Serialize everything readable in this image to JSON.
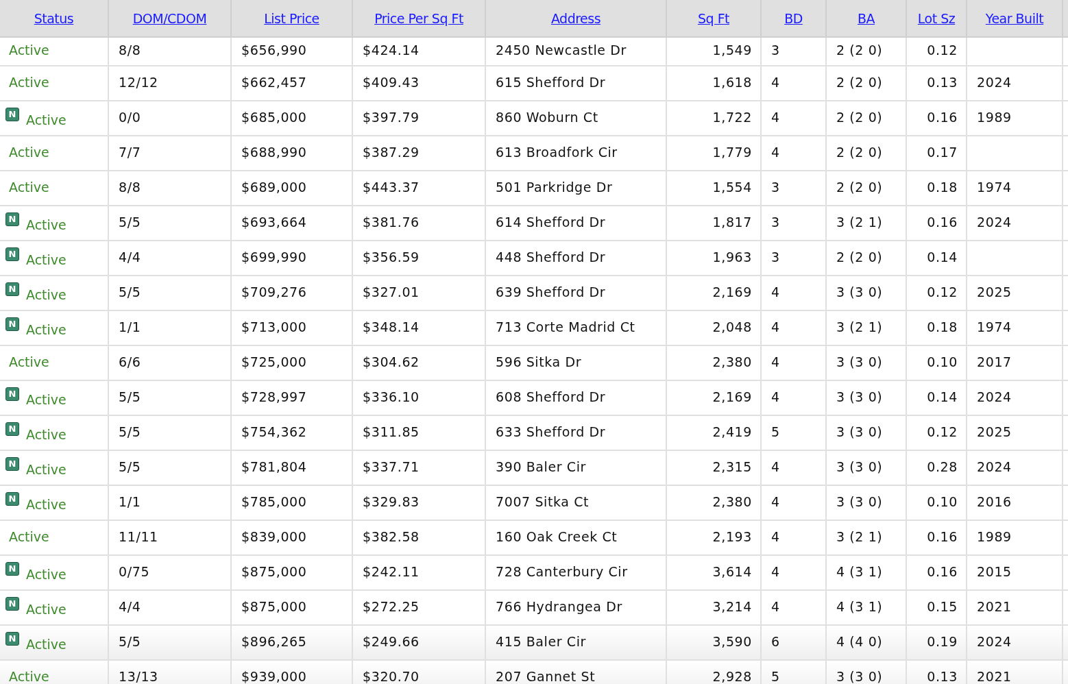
{
  "table": {
    "columns": [
      {
        "label": "Status"
      },
      {
        "label": "DOM/CDOM"
      },
      {
        "label": "List Price"
      },
      {
        "label": "Price Per Sq Ft"
      },
      {
        "label": "Address"
      },
      {
        "label": "Sq Ft"
      },
      {
        "label": "BD"
      },
      {
        "label": "BA"
      },
      {
        "label": "Lot Sz"
      },
      {
        "label": "Year Built"
      }
    ],
    "rows": [
      {
        "status": "Active",
        "dom": "8/8",
        "price": "$656,990",
        "ppsf": "$424.14",
        "address": "2450 Newcastle Dr",
        "sqft": "1,549",
        "bd": "3",
        "ba": "2 (2 0)",
        "lot": "0.12"
      },
      {
        "status": "Active",
        "dom": "12/12",
        "price": "$662,457",
        "ppsf": "$409.43",
        "address": "615 Shefford Dr",
        "sqft": "1,618",
        "bd": "4",
        "ba": "2 (2 0)",
        "lot": "0.13",
        "year": "2024"
      },
      {
        "badge": "N",
        "status": "Active",
        "dom": "0/0",
        "price": "$685,000",
        "ppsf": "$397.79",
        "address": "860 Woburn Ct",
        "sqft": "1,722",
        "bd": "4",
        "ba": "2 (2 0)",
        "lot": "0.16",
        "year": "1989"
      },
      {
        "status": "Active",
        "dom": "7/7",
        "price": "$688,990",
        "ppsf": "$387.29",
        "address": "613 Broadfork Cir",
        "sqft": "1,779",
        "bd": "4",
        "ba": "2 (2 0)",
        "lot": "0.17"
      },
      {
        "status": "Active",
        "dom": "8/8",
        "price": "$689,000",
        "ppsf": "$443.37",
        "address": "501 Parkridge Dr",
        "sqft": "1,554",
        "bd": "3",
        "ba": "2 (2 0)",
        "lot": "0.18",
        "year": "1974"
      },
      {
        "badge": "N",
        "status": "Active",
        "dom": "5/5",
        "price": "$693,664",
        "ppsf": "$381.76",
        "address": "614 Shefford Dr",
        "sqft": "1,817",
        "bd": "3",
        "ba": "3 (2 1)",
        "lot": "0.16",
        "year": "2024"
      },
      {
        "badge": "N",
        "status": "Active",
        "dom": "4/4",
        "price": "$699,990",
        "ppsf": "$356.59",
        "address": "448 Shefford Dr",
        "sqft": "1,963",
        "bd": "3",
        "ba": "2 (2 0)",
        "lot": "0.14"
      },
      {
        "badge": "N",
        "status": "Active",
        "dom": "5/5",
        "price": "$709,276",
        "ppsf": "$327.01",
        "address": "639 Shefford Dr",
        "sqft": "2,169",
        "bd": "4",
        "ba": "3 (3 0)",
        "lot": "0.12",
        "year": "2025"
      },
      {
        "badge": "N",
        "status": "Active",
        "dom": "1/1",
        "price": "$713,000",
        "ppsf": "$348.14",
        "address": "713 Corte Madrid Ct",
        "sqft": "2,048",
        "bd": "4",
        "ba": "3 (2 1)",
        "lot": "0.18",
        "year": "1974"
      },
      {
        "status": "Active",
        "dom": "6/6",
        "price": "$725,000",
        "ppsf": "$304.62",
        "address": "596 Sitka Dr",
        "sqft": "2,380",
        "bd": "4",
        "ba": "3 (3 0)",
        "lot": "0.10",
        "year": "2017"
      },
      {
        "badge": "N",
        "status": "Active",
        "dom": "5/5",
        "price": "$728,997",
        "ppsf": "$336.10",
        "address": "608 Shefford Dr",
        "sqft": "2,169",
        "bd": "4",
        "ba": "3 (3 0)",
        "lot": "0.14",
        "year": "2024"
      },
      {
        "badge": "N",
        "status": "Active",
        "dom": "5/5",
        "price": "$754,362",
        "ppsf": "$311.85",
        "address": "633 Shefford Dr",
        "sqft": "2,419",
        "bd": "5",
        "ba": "3 (3 0)",
        "lot": "0.12",
        "year": "2025"
      },
      {
        "badge": "N",
        "status": "Active",
        "dom": "5/5",
        "price": "$781,804",
        "ppsf": "$337.71",
        "address": "390 Baler Cir",
        "sqft": "2,315",
        "bd": "4",
        "ba": "3 (3 0)",
        "lot": "0.28",
        "year": "2024"
      },
      {
        "badge": "N",
        "status": "Active",
        "dom": "1/1",
        "price": "$785,000",
        "ppsf": "$329.83",
        "address": "7007 Sitka Ct",
        "sqft": "2,380",
        "bd": "4",
        "ba": "3 (3 0)",
        "lot": "0.10",
        "year": "2016"
      },
      {
        "status": "Active",
        "dom": "11/11",
        "price": "$839,000",
        "ppsf": "$382.58",
        "address": "160 Oak Creek Ct",
        "sqft": "2,193",
        "bd": "4",
        "ba": "3 (2 1)",
        "lot": "0.16",
        "year": "1989"
      },
      {
        "badge": "N",
        "status": "Active",
        "dom": "0/75",
        "price": "$875,000",
        "ppsf": "$242.11",
        "address": "728 Canterbury Cir",
        "sqft": "3,614",
        "bd": "4",
        "ba": "4 (3 1)",
        "lot": "0.16",
        "year": "2015"
      },
      {
        "badge": "N",
        "status": "Active",
        "dom": "4/4",
        "price": "$875,000",
        "ppsf": "$272.25",
        "address": "766 Hydrangea Dr",
        "sqft": "3,214",
        "bd": "4",
        "ba": "4 (3 1)",
        "lot": "0.15",
        "year": "2021"
      },
      {
        "badge": "N",
        "status": "Active",
        "dom": "5/5",
        "price": "$896,265",
        "ppsf": "$249.66",
        "address": "415 Baler Cir",
        "sqft": "3,590",
        "bd": "6",
        "ba": "4 (4 0)",
        "lot": "0.19",
        "year": "2024"
      },
      {
        "status": "Active",
        "dom": "13/13",
        "price": "$939,000",
        "ppsf": "$320.70",
        "address": "207 Gannet St",
        "sqft": "2,928",
        "bd": "5",
        "ba": "3 (3 0)",
        "lot": "0.13",
        "year": "2021"
      }
    ]
  }
}
